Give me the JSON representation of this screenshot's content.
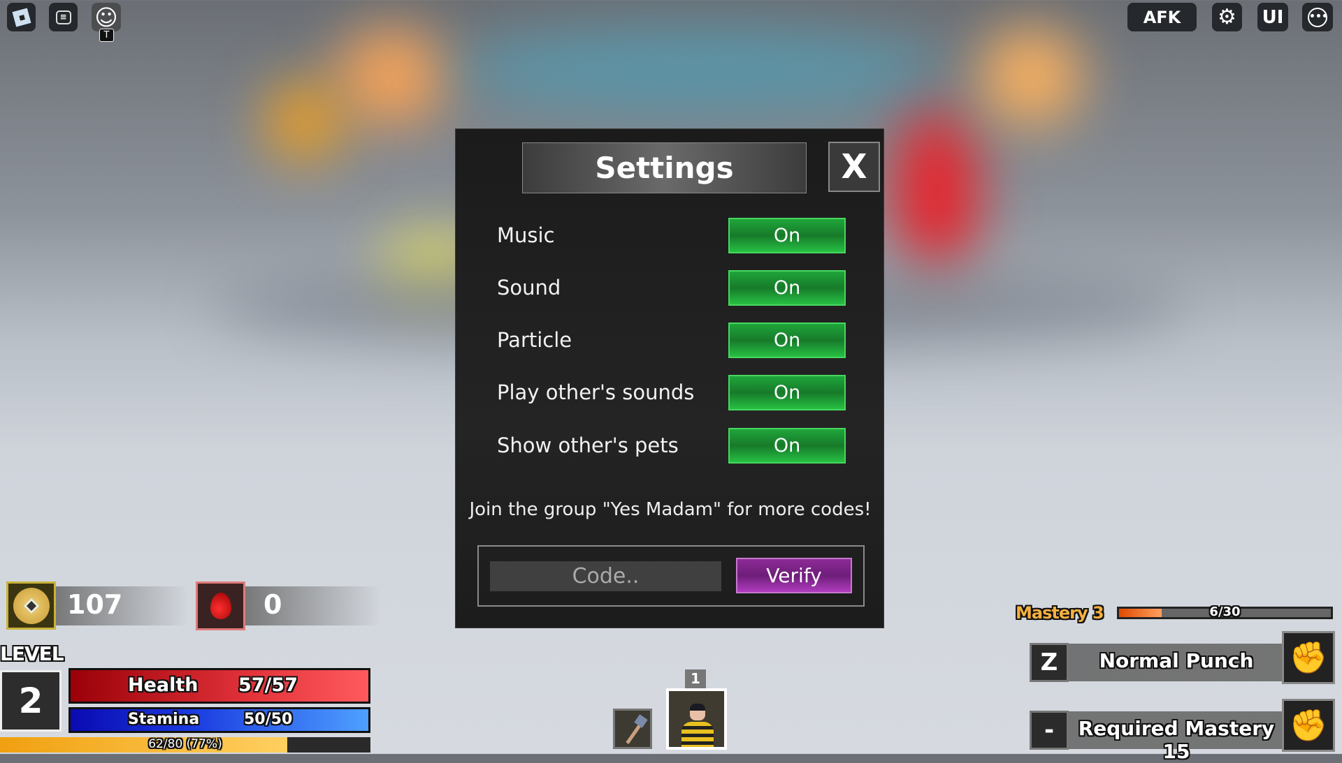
{
  "top_left": {
    "icons": [
      "roblox-menu-icon",
      "chat-icon",
      "emote-icon"
    ],
    "emote_hotkey": "T"
  },
  "top_right": {
    "afk_label": "AFK",
    "ui_label": "UI",
    "icons": [
      "gear-icon",
      "more-icon"
    ]
  },
  "settings": {
    "title": "Settings",
    "close_label": "X",
    "rows": [
      {
        "label": "Music",
        "value": "On"
      },
      {
        "label": "Sound",
        "value": "On"
      },
      {
        "label": "Particle",
        "value": "On"
      },
      {
        "label": "Play other's sounds",
        "value": "On"
      },
      {
        "label": "Show other's pets",
        "value": "On"
      }
    ],
    "group_message": "Join the group \"Yes Madam\" for more codes!",
    "code_placeholder": "Code..",
    "verify_label": "Verify",
    "colors": {
      "toggle_on": "#1fa53a",
      "verify": "#9b2ca6"
    }
  },
  "currency": {
    "coins": "107",
    "blood": "0"
  },
  "player": {
    "level_label": "LEVEL",
    "level": "2",
    "health_label": "Health",
    "health": "57/57",
    "health_fraction": 1.0,
    "stamina_label": "Stamina",
    "stamina": "50/50",
    "stamina_fraction": 1.0,
    "xp": "62/80 (77%)",
    "xp_fraction": 0.775
  },
  "hotbar": {
    "slots": [
      {
        "number": "1",
        "item": "character"
      }
    ],
    "extra_item": "axe"
  },
  "mastery": {
    "label": "Mastery 3",
    "progress": "6/30",
    "fraction": 0.2
  },
  "skills": [
    {
      "key": "Z",
      "name": "Normal Punch",
      "icon": "fist-punch-icon"
    },
    {
      "key": "-",
      "name": "Required Mastery 15",
      "icon": "fist-combo-icon"
    }
  ]
}
